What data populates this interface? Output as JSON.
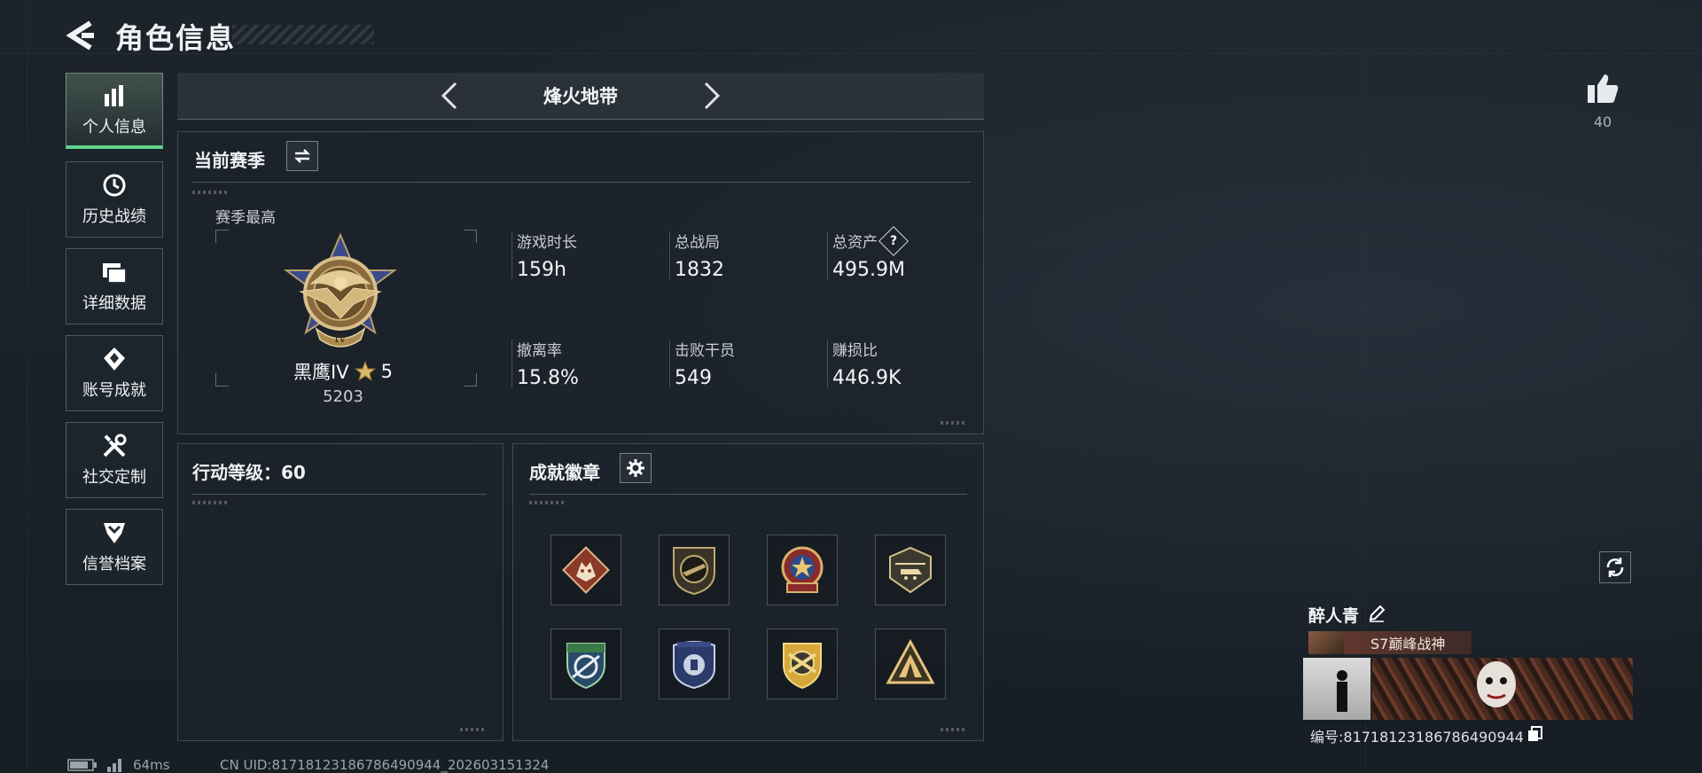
{
  "header": {
    "title": "角色信息"
  },
  "sidebar": {
    "items": [
      {
        "label": "个人信息",
        "icon": "bar-chart-icon",
        "active": true
      },
      {
        "label": "历史战绩",
        "icon": "history-icon",
        "active": false
      },
      {
        "label": "详细数据",
        "icon": "folders-icon",
        "active": false
      },
      {
        "label": "账号成就",
        "icon": "achievement-icon",
        "active": false
      },
      {
        "label": "社交定制",
        "icon": "tools-icon",
        "active": false
      },
      {
        "label": "信誉档案",
        "icon": "shield-rank-icon",
        "active": false
      }
    ],
    "active_color": "#5fd18c"
  },
  "mode": {
    "name": "烽火地带"
  },
  "season": {
    "title": "当前赛季",
    "peak_label": "赛季最高",
    "rank_name": "黑鹰IV",
    "rank_stars": "5",
    "rank_points": "5203",
    "rank_emblem_numeral": "IV",
    "stats": [
      {
        "label": "游戏时长",
        "value": "159h"
      },
      {
        "label": "总战局",
        "value": "1832"
      },
      {
        "label": "总资产",
        "value": "495.9M",
        "help": "?"
      },
      {
        "label": "撤离率",
        "value": "15.8%"
      },
      {
        "label": "击败干员",
        "value": "549"
      },
      {
        "label": "赚损比",
        "value": "446.9K"
      }
    ]
  },
  "action_level": {
    "label": "行动等级：60"
  },
  "achievements": {
    "title": "成就徽章",
    "badges": [
      "wolf-badge-icon",
      "rifle-badge-icon",
      "star-badge-icon",
      "helicopter-badge-icon",
      "crosshair-badge-icon",
      "police-badge-icon",
      "gold-cross-badge-icon",
      "tent-badge-icon"
    ]
  },
  "likes": {
    "count": "40"
  },
  "profile": {
    "name": "醉人青",
    "title_badge": "S7巅峰战神",
    "id_label": "编号:81718123186786490944"
  },
  "footer": {
    "ping": "64ms",
    "uid": "CN UID:81718123186786490944_202603151324"
  }
}
